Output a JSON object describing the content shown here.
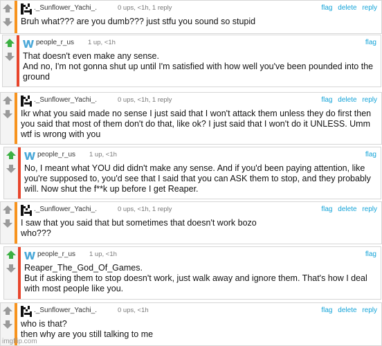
{
  "comments": [
    {
      "username": "._Sunflower_Yachi_.",
      "meta": "0 ups, <1h, 1 reply",
      "actions": [
        "flag",
        "delete",
        "reply"
      ],
      "lines": [
        "Bruh what??? are you dumb??? just stfu you sound so stupid"
      ],
      "accent": "#f7931e",
      "up_active": false
    },
    {
      "username": "people_r_us",
      "meta": "1 up, <1h",
      "actions": [
        "flag"
      ],
      "lines": [
        "That doesn't even make any sense.",
        "And no, I'm not gonna shut up until I'm satisfied with how well you've been pounded into the ground"
      ],
      "accent": "#e8452c",
      "up_active": true
    },
    {
      "username": "._Sunflower_Yachi_.",
      "meta": "0 ups, <1h, 1 reply",
      "actions": [
        "flag",
        "delete",
        "reply"
      ],
      "lines": [
        "Ikr what you said made no sense I just said that I won't attack them unless they do first then you said that most of them don't do that, like ok? I just said that I won't do it UNLESS. Umm wtf is wrong with you"
      ],
      "accent": "#f7931e",
      "up_active": false
    },
    {
      "username": "people_r_us",
      "meta": "1 up, <1h",
      "actions": [
        "flag"
      ],
      "lines": [
        "No, I meant what YOU did didn't make any sense. And if you'd been paying attention, like you're supposed to, you'd see that I said that you can ASK them to stop, and they probably will. Now shut the f**k up before I get Reaper."
      ],
      "accent": "#e8452c",
      "up_active": true
    },
    {
      "username": "._Sunflower_Yachi_.",
      "meta": "0 ups, <1h, 1 reply",
      "actions": [
        "flag",
        "delete",
        "reply"
      ],
      "lines": [
        "I saw that you said that but sometimes that doesn't work bozo",
        "who???"
      ],
      "accent": "#f7931e",
      "up_active": false
    },
    {
      "username": "people_r_us",
      "meta": "1 up, <1h",
      "actions": [
        "flag"
      ],
      "lines": [
        "Reaper_The_God_Of_Games.",
        "But if asking them to stop doesn't work, just walk away and ignore them. That's how I deal with most people like you."
      ],
      "accent": "#e8452c",
      "up_active": true
    },
    {
      "username": "._Sunflower_Yachi_.",
      "meta": "0 ups, <1h",
      "actions": [
        "flag",
        "delete",
        "reply"
      ],
      "lines": [
        "who is that?",
        "then why are you still talking to me"
      ],
      "accent": "#f7931e",
      "up_active": false
    }
  ],
  "watermark": "imgflip.com",
  "colors": {
    "link": "#13a3d8",
    "upvote_active": "#3cb043",
    "vote_inactive": "#9a9a9a",
    "border": "#d6d6d6"
  },
  "icons": {
    "upvote": "upvote-arrow-icon",
    "downvote": "downvote-arrow-icon",
    "avatar_sunflower": "pixel-avatar-icon",
    "avatar_people": "w-logo-avatar-icon"
  }
}
